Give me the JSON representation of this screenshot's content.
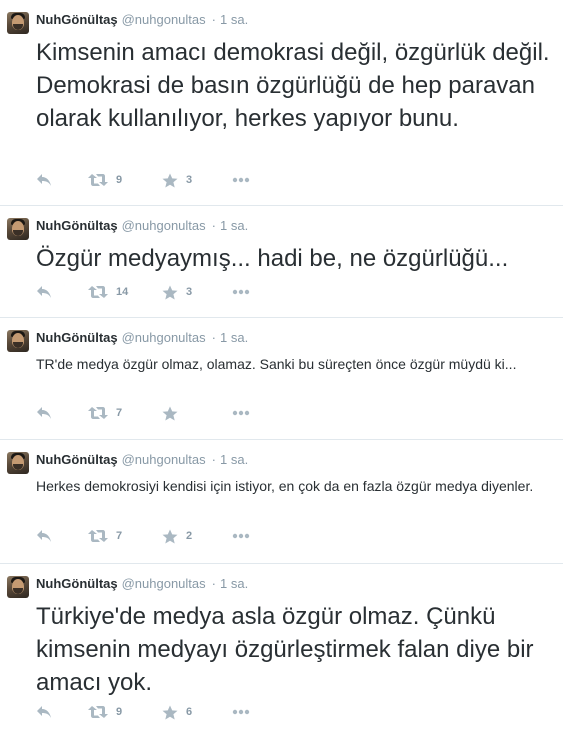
{
  "tweets": [
    {
      "name": "NuhGönültaş",
      "handle": "@nuhgonultas",
      "separator": "·",
      "time": "1 sa.",
      "text": "Kimsenin amacı demokrasi değil, özgürlük değil. Demokrasi de basın özgürlüğü de hep paravan olarak kullanılıyor, herkes yapıyor bunu.",
      "retweets": "9",
      "favorites": "3"
    },
    {
      "name": "NuhGönültaş",
      "handle": "@nuhgonultas",
      "separator": "·",
      "time": "1 sa.",
      "text": "Özgür medyaymış... hadi be, ne özgürlüğü...",
      "retweets": "14",
      "favorites": "3"
    },
    {
      "name": "NuhGönültaş",
      "handle": "@nuhgonultas",
      "separator": "·",
      "time": "1 sa.",
      "text": "TR'de medya özgür olmaz, olamaz. Sanki bu süreçten önce özgür müydü ki...",
      "retweets": "7",
      "favorites": ""
    },
    {
      "name": "NuhGönültaş",
      "handle": "@nuhgonultas",
      "separator": "·",
      "time": "1 sa.",
      "text": "Herkes demokrosiyi kendisi için istiyor, en çok da en fazla özgür medya diyenler.",
      "retweets": "7",
      "favorites": "2"
    },
    {
      "name": "NuhGönültaş",
      "handle": "@nuhgonultas",
      "separator": "·",
      "time": "1 sa.",
      "text": "Türkiye'de medya asla özgür olmaz. Çünkü kimsenin medyayı özgürleştirmek falan diye bir amacı yok.",
      "retweets": "9",
      "favorites": "6"
    }
  ],
  "icons": {
    "reply": "reply-icon",
    "retweet": "retweet-icon",
    "favorite": "star-icon",
    "more": "more-icon"
  },
  "colors": {
    "text": "#292f33",
    "muted": "#8899a6",
    "icon": "#aab8c2",
    "divider": "#e1e8ed"
  }
}
